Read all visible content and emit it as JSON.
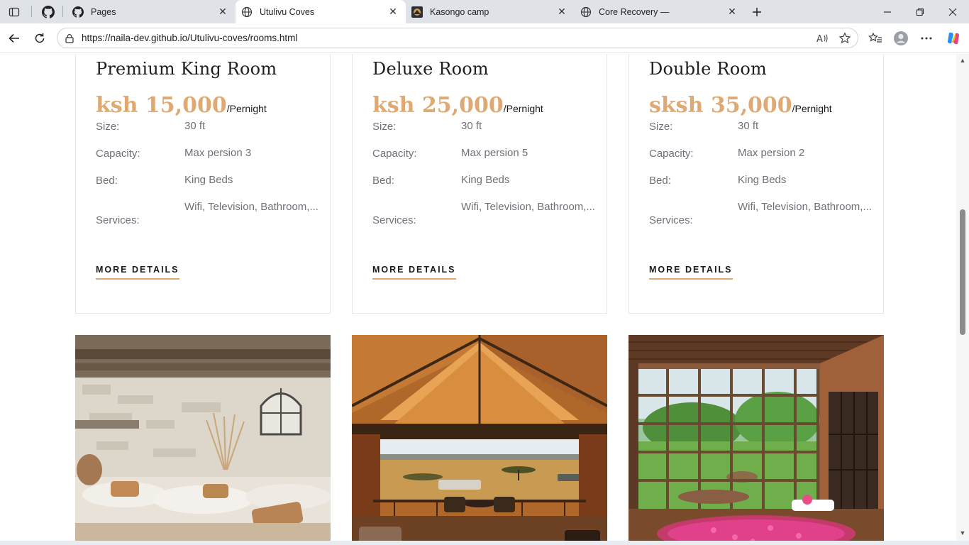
{
  "browser": {
    "tabs": [
      {
        "title": "Pages"
      },
      {
        "title": "Utulivu Coves"
      },
      {
        "title": "Kasongo camp"
      },
      {
        "title": "Core Recovery —"
      }
    ],
    "url": "https://naila-dev.github.io/Utulivu-coves/rooms.html"
  },
  "rooms": [
    {
      "name": "Premium King Room",
      "price": "ksh 15,000",
      "per": "/Pernight",
      "size_label": "Size:",
      "size": "30 ft",
      "capacity_label": "Capacity:",
      "capacity": "Max persion 3",
      "bed_label": "Bed:",
      "bed": "King Beds",
      "services_label": "Services:",
      "services": "Wifi, Television, Bathroom,...",
      "more": "MORE DETAILS"
    },
    {
      "name": "Deluxe Room",
      "price": "ksh 25,000",
      "per": "/Pernight",
      "size_label": "Size:",
      "size": "30 ft",
      "capacity_label": "Capacity:",
      "capacity": "Max persion 5",
      "bed_label": "Bed:",
      "bed": "King Beds",
      "services_label": "Services:",
      "services": "Wifi, Television, Bathroom,...",
      "more": "MORE DETAILS"
    },
    {
      "name": "Double Room",
      "price": "sksh 35,000",
      "per": "/Pernight",
      "size_label": "Size:",
      "size": "30 ft",
      "capacity_label": "Capacity:",
      "capacity": "Max persion 2",
      "bed_label": "Bed:",
      "bed": "King Beds",
      "services_label": "Services:",
      "services": "Wifi, Television, Bathroom,...",
      "more": "MORE DETAILS"
    }
  ],
  "colors": {
    "accent": "#dfa974",
    "heading": "#1e1e1e",
    "spec_text": "#707079"
  }
}
